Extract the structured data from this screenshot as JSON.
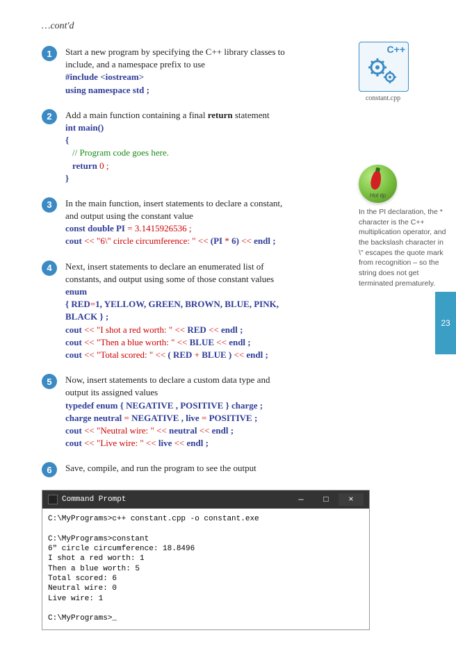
{
  "contd": "…cont'd",
  "steps": [
    {
      "num": "1",
      "text": "Start a new program by specifying the C++ library classes to include, and a namespace prefix to use",
      "code1": "#include <iostream>",
      "code2": "using namespace std ;"
    },
    {
      "num": "2",
      "text_a": "Add a main function containing a final ",
      "text_b": "return",
      "text_c": " statement",
      "code1": "int main()",
      "code2": "{",
      "code3": "// Program code goes here.",
      "code4a": "return",
      "code4b": " 0 ;",
      "code5": "}"
    },
    {
      "num": "3",
      "text": "In the main function, insert statements to declare a constant, and output using the constant value",
      "code1a": "const double",
      "code1b": " PI ",
      "code1c": "=",
      "code1d": " 3.1415926536 ;",
      "code2a": "cout ",
      "code2b": "<<",
      "code2c": " \"6\\\" circle circumference: \" ",
      "code2d": "<<",
      "code2e": " (PI ",
      "code2f": "*",
      "code2g": " 6) ",
      "code2h": "<<",
      "code2i": " endl ;"
    },
    {
      "num": "4",
      "text": "Next, insert statements to declare an enumerated list of constants, and output using some of those constant values",
      "code1": "enum",
      "code2a": "{ RED",
      "code2b": "=",
      "code2c": "1, YELLOW, GREEN, BROWN, BLUE, PINK, BLACK } ;",
      "code3a": "cout ",
      "code3b": "<<",
      "code3c": " \"I shot a red worth: \" ",
      "code3d": "<<",
      "code3e": " RED ",
      "code3f": "<<",
      "code3g": " endl ;",
      "code4a": "cout ",
      "code4b": "<<",
      "code4c": " \"Then a blue worth: \" ",
      "code4d": "<<",
      "code4e": " BLUE ",
      "code4f": "<<",
      "code4g": " endl ;",
      "code5a": "cout ",
      "code5b": "<<",
      "code5c": " \"Total scored: \" ",
      "code5d": "<<",
      "code5e": " ( RED ",
      "code5f": "+",
      "code5g": " BLUE ) ",
      "code5h": "<<",
      "code5i": " endl ;"
    },
    {
      "num": "5",
      "text": "Now, insert statements to declare a custom data type and output its assigned values",
      "code1a": "typedef enum",
      "code1b": " { NEGATIVE , POSITIVE } charge ;",
      "code2a": "charge neutral ",
      "code2b": "=",
      "code2c": " NEGATIVE , live ",
      "code2d": "=",
      "code2e": " POSITIVE ;",
      "code3a": "cout ",
      "code3b": "<<",
      "code3c": " \"Neutral wire: \" ",
      "code3d": "<<",
      "code3e": " neutral ",
      "code3f": "<<",
      "code3g": " endl ;",
      "code4a": "cout ",
      "code4b": "<<",
      "code4c": " \"Live wire: \" ",
      "code4d": "<<",
      "code4e": " live ",
      "code4f": "<<",
      "code4g": " endl ;"
    },
    {
      "num": "6",
      "text": "Save, compile, and run the program to see the output"
    }
  ],
  "sidebar": {
    "cpp_label": "C++",
    "filename": "constant.cpp",
    "hottip_label": "Hot tip",
    "tip_text": "In the PI declaration, the * character is the C++ multiplication operator, and the backslash character in \\\" escapes the quote mark from recognition – so the string does not get terminated prematurely."
  },
  "page_number": "23",
  "terminal": {
    "title": "Command Prompt",
    "min": "—",
    "max": "□",
    "close": "×",
    "body": "C:\\MyPrograms>c++ constant.cpp -o constant.exe\n\nC:\\MyPrograms>constant\n6\" circle circumference: 18.8496\nI shot a red worth: 1\nThen a blue worth: 5\nTotal scored: 6\nNeutral wire: 0\nLive wire: 1\n\nC:\\MyPrograms>_"
  }
}
